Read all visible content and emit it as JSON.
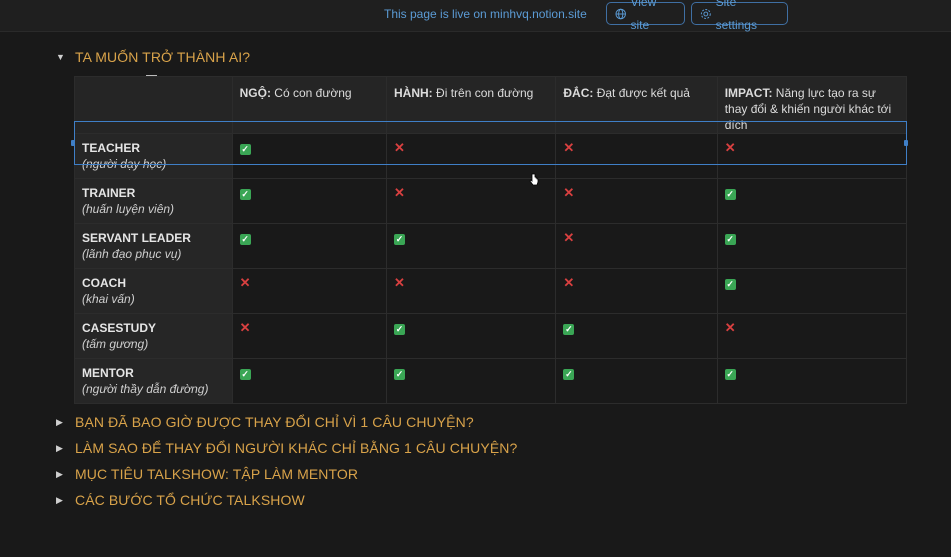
{
  "topbar": {
    "live_text": "This page is live on minhvq.notion.site",
    "view_site": "View site",
    "site_settings": "Site settings"
  },
  "main_toggle": "TA MUỐN TRỞ THÀNH AI?",
  "table": {
    "headers": [
      {
        "bold": "NGỘ:",
        "text": " Có con đường"
      },
      {
        "bold": "HÀNH:",
        "text": " Đi trên con đường"
      },
      {
        "bold": "ĐẮC:",
        "text": " Đạt được kết quả"
      },
      {
        "bold": "IMPACT:",
        "text": " Năng lực tạo ra sự thay đổi & khiến người khác tới đích"
      }
    ],
    "rows": [
      {
        "name": "TEACHER",
        "sub": "(người dạy học)",
        "cells": [
          "check",
          "cross",
          "cross",
          "cross"
        ]
      },
      {
        "name": "TRAINER",
        "sub": "(huấn luyện viên)",
        "cells": [
          "check",
          "cross",
          "cross",
          "check"
        ]
      },
      {
        "name": "SERVANT LEADER",
        "sub": "(lãnh đạo phục vụ)",
        "cells": [
          "check",
          "check",
          "cross",
          "check"
        ]
      },
      {
        "name": "COACH",
        "sub": "(khai vấn)",
        "cells": [
          "cross",
          "cross",
          "cross",
          "check"
        ]
      },
      {
        "name": "CASESTUDY",
        "sub": "(tấm gương)",
        "cells": [
          "cross",
          "check",
          "check",
          "cross"
        ]
      },
      {
        "name": "MENTOR",
        "sub": "(người thầy dẫn đường)",
        "cells": [
          "check",
          "check",
          "check",
          "check"
        ]
      }
    ]
  },
  "toggles": [
    "BẠN ĐÃ BAO GIỜ ĐƯỢC THAY ĐỔI CHỈ VÌ 1 CÂU CHUYỆN?",
    "LÀM SAO ĐỂ THAY ĐỔI NGƯỜI KHÁC CHỈ BẰNG 1 CÂU CHUYỆN?",
    "MỤC TIÊU TALKSHOW: TẬP LÀM MENTOR",
    "CÁC BƯỚC TỔ CHỨC TALKSHOW"
  ],
  "colors": {
    "accent": "#d9a34a",
    "link": "#5b9bd5",
    "check": "#3aa655",
    "cross": "#d94040"
  }
}
